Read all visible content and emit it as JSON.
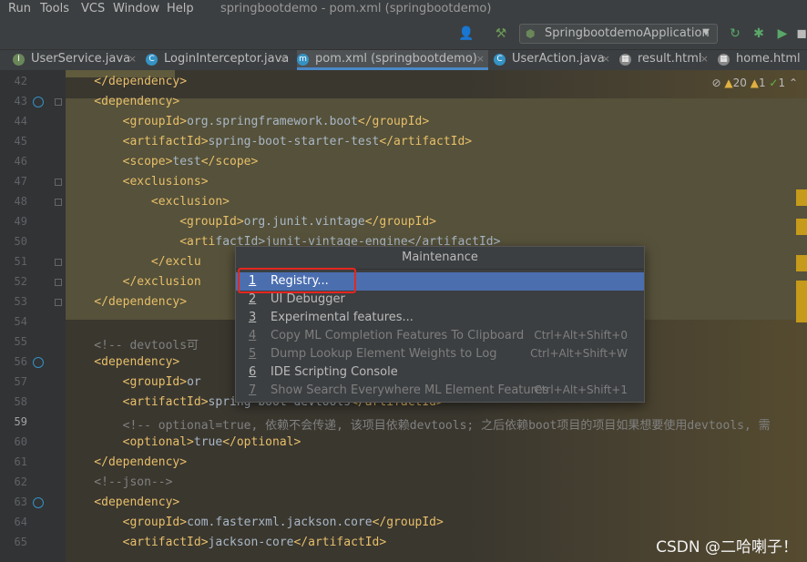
{
  "menubar": {
    "items": [
      "Run",
      "Tools",
      "VCS",
      "Window",
      "Help"
    ],
    "title": "springbootdemo - pom.xml (springbootdemo)"
  },
  "toolbar": {
    "user_icon": "user-icon",
    "build_icon": "hammer-icon",
    "run_config": "SpringbootdemoApplication",
    "icons": [
      "rerun-icon",
      "debug-icon",
      "coverage-icon",
      "stop-icon"
    ]
  },
  "tabs": [
    {
      "label": "UserService.java",
      "icon": "I",
      "color": "#6a8759"
    },
    {
      "label": "LoginInterceptor.java",
      "icon": "C",
      "color": "#3592c4"
    },
    {
      "label": "pom.xml (springbootdemo)",
      "icon": "m",
      "color": "#3592c4",
      "active": true
    },
    {
      "label": "UserAction.java",
      "icon": "C",
      "color": "#3592c4"
    },
    {
      "label": "result.html",
      "icon": "▦",
      "color": "#888888"
    },
    {
      "label": "home.html",
      "icon": "▦",
      "color": "#888888"
    }
  ],
  "inspections": {
    "warnings": "20",
    "weak": "1",
    "ok": "1"
  },
  "editor": {
    "current_line": "59",
    "lines": [
      {
        "n": "42",
        "tokens": [
          [
            "tag",
            "    </dependency>"
          ]
        ]
      },
      {
        "n": "43",
        "tokens": [
          [
            "tag",
            "    <dependency>"
          ]
        ]
      },
      {
        "n": "44",
        "tokens": [
          [
            "tag",
            "        <groupId>"
          ],
          [
            "txt",
            "org.springframework.boot"
          ],
          [
            "tag",
            "</groupId>"
          ]
        ]
      },
      {
        "n": "45",
        "tokens": [
          [
            "tag",
            "        <artifactId>"
          ],
          [
            "txt",
            "spring-boot-starter-test"
          ],
          [
            "tag",
            "</artifactId>"
          ]
        ]
      },
      {
        "n": "46",
        "tokens": [
          [
            "tag",
            "        <scope>"
          ],
          [
            "txt",
            "test"
          ],
          [
            "tag",
            "</scope>"
          ]
        ]
      },
      {
        "n": "47",
        "tokens": [
          [
            "tag",
            "        <exclusions>"
          ]
        ]
      },
      {
        "n": "48",
        "tokens": [
          [
            "tag",
            "            <exclusion>"
          ]
        ]
      },
      {
        "n": "49",
        "tokens": [
          [
            "tag",
            "                <groupId>"
          ],
          [
            "txt",
            "org.junit.vintage"
          ],
          [
            "tag",
            "</groupId>"
          ]
        ]
      },
      {
        "n": "50",
        "tokens": [
          [
            "tag",
            "                <arti"
          ],
          [
            "txt",
            "factId>junit-vintage-engine</artifactId>"
          ]
        ]
      },
      {
        "n": "51",
        "tokens": [
          [
            "tag",
            "            </exclu"
          ]
        ]
      },
      {
        "n": "52",
        "tokens": [
          [
            "tag",
            "        </exclusion"
          ]
        ]
      },
      {
        "n": "53",
        "tokens": [
          [
            "tag",
            "    </dependency>"
          ]
        ]
      },
      {
        "n": "54",
        "tokens": [
          [
            "txt",
            ""
          ]
        ]
      },
      {
        "n": "55",
        "tokens": [
          [
            "cmt",
            "    <!-- devtools可"
          ]
        ]
      },
      {
        "n": "56",
        "tokens": [
          [
            "tag",
            "    <dependency>"
          ]
        ]
      },
      {
        "n": "57",
        "tokens": [
          [
            "tag",
            "        <groupId>"
          ],
          [
            "txt",
            "or"
          ]
        ]
      },
      {
        "n": "58",
        "tokens": [
          [
            "tag",
            "        <artifactId>"
          ],
          [
            "txt",
            "spring-boot-devtools"
          ],
          [
            "tag",
            "</artifactId>"
          ]
        ]
      },
      {
        "n": "59",
        "tokens": [
          [
            "cmt",
            "        <!-- optional=true, 依赖不会传递, 该项目依赖devtools; 之后依赖boot项目的项目如果想要使用devtools, 需"
          ]
        ]
      },
      {
        "n": "60",
        "tokens": [
          [
            "tag",
            "        <optional>"
          ],
          [
            "txt",
            "true"
          ],
          [
            "tag",
            "</optional>"
          ]
        ]
      },
      {
        "n": "61",
        "tokens": [
          [
            "tag",
            "    </dependency>"
          ]
        ]
      },
      {
        "n": "62",
        "tokens": [
          [
            "cmt",
            "    <!--json-->"
          ]
        ]
      },
      {
        "n": "63",
        "tokens": [
          [
            "tag",
            "    <dependency>"
          ]
        ]
      },
      {
        "n": "64",
        "tokens": [
          [
            "tag",
            "        <groupId>"
          ],
          [
            "txt",
            "com.fasterxml.jackson.core"
          ],
          [
            "tag",
            "</groupId>"
          ]
        ]
      },
      {
        "n": "65",
        "tokens": [
          [
            "tag",
            "        <artifactId>"
          ],
          [
            "txt",
            "jackson-core"
          ],
          [
            "tag",
            "</artifactId>"
          ]
        ]
      }
    ]
  },
  "popup": {
    "title": "Maintenance",
    "items": [
      {
        "num": "1",
        "label": "Registry...",
        "shortcut": "",
        "state": "sel"
      },
      {
        "num": "2",
        "label": "UI Debugger",
        "shortcut": "",
        "state": "en"
      },
      {
        "num": "3",
        "label": "Experimental features...",
        "shortcut": "",
        "state": "en"
      },
      {
        "num": "4",
        "label": "Copy ML Completion Features To Clipboard",
        "shortcut": "Ctrl+Alt+Shift+0",
        "state": "dis"
      },
      {
        "num": "5",
        "label": "Dump Lookup Element Weights to Log",
        "shortcut": "Ctrl+Alt+Shift+W",
        "state": "dis"
      },
      {
        "num": "6",
        "label": "IDE Scripting Console",
        "shortcut": "",
        "state": "en"
      },
      {
        "num": "7",
        "label": "Show Search Everywhere ML Element Features",
        "shortcut": "Ctrl+Alt+Shift+1",
        "state": "dis"
      }
    ]
  },
  "watermark": "CSDN @二哈喇子！"
}
